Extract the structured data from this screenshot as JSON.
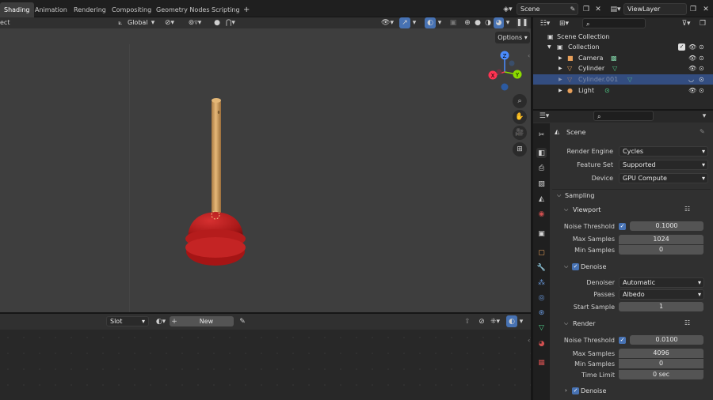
{
  "workspace_tabs": [
    "Shading",
    "Animation",
    "Rendering",
    "Compositing",
    "Geometry Nodes",
    "Scripting"
  ],
  "add_tab_glyph": "+",
  "scene_field": "Scene",
  "viewlayer_field": "ViewLayer",
  "viewport": {
    "left_mode_fragment": "ect",
    "transform_orientation": "Global",
    "options_label": "Options",
    "gizmo_axes": {
      "x": "X",
      "y": "Y",
      "z": "Z"
    }
  },
  "lower_editor": {
    "slot_label": "Slot",
    "new_label": "New"
  },
  "outliner": {
    "rows": [
      {
        "label": "Scene Collection",
        "indent": 0,
        "icon": "collection-icon",
        "color": "#dcdcdc",
        "selected": false
      },
      {
        "label": "Collection",
        "indent": 1,
        "icon": "collection-icon",
        "color": "#dcdcdc",
        "selected": false
      },
      {
        "label": "Camera",
        "indent": 2,
        "icon": "camera-icon",
        "color": "#dcdcdc",
        "selected": false
      },
      {
        "label": "Cylinder",
        "indent": 2,
        "icon": "mesh-icon",
        "color": "#dcdcdc",
        "selected": false
      },
      {
        "label": "Cylinder.001",
        "indent": 2,
        "icon": "mesh-icon",
        "color": "#7d8aa6",
        "selected": true
      },
      {
        "label": "Light",
        "indent": 2,
        "icon": "light-icon",
        "color": "#dcdcdc",
        "selected": false
      }
    ]
  },
  "properties": {
    "context_label": "Scene",
    "render_engine": {
      "label": "Render Engine",
      "value": "Cycles"
    },
    "feature_set": {
      "label": "Feature Set",
      "value": "Supported"
    },
    "device": {
      "label": "Device",
      "value": "GPU Compute"
    },
    "sampling_title": "Sampling",
    "viewport_title": "Viewport",
    "vp_noise_threshold": {
      "label": "Noise Threshold",
      "value": "0.1000"
    },
    "vp_max_samples": {
      "label": "Max Samples",
      "value": "1024"
    },
    "vp_min_samples": {
      "label": "Min Samples",
      "value": "0"
    },
    "denoise_title": "Denoise",
    "denoiser": {
      "label": "Denoiser",
      "value": "Automatic"
    },
    "passes": {
      "label": "Passes",
      "value": "Albedo"
    },
    "start_sample": {
      "label": "Start Sample",
      "value": "1"
    },
    "render_title": "Render",
    "r_noise_threshold": {
      "label": "Noise Threshold",
      "value": "0.0100"
    },
    "r_max_samples": {
      "label": "Max Samples",
      "value": "4096"
    },
    "r_min_samples": {
      "label": "Min Samples",
      "value": "0"
    },
    "r_time_limit": {
      "label": "Time Limit",
      "value": "0 sec"
    },
    "denoise2_title": "Denoise"
  },
  "colors": {
    "accent": "#4772b3",
    "selection": "#334d80",
    "plunger_cup": "#b01e1e",
    "handle": "#d9a866"
  }
}
